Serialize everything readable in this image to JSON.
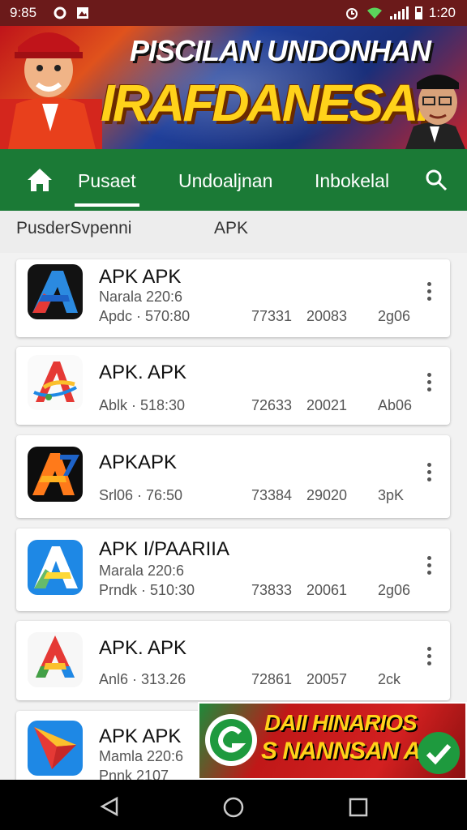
{
  "status_bar": {
    "time": "9:85",
    "clock": "1:20"
  },
  "banner": {
    "line1": "PISCILAN UNDONHAN",
    "line2": "IRAFDANESAI"
  },
  "nav": {
    "tabs": [
      {
        "label": "Pusaet"
      },
      {
        "label": "Undoaljnan"
      },
      {
        "label": "Inbokelal"
      }
    ]
  },
  "subtabs": [
    {
      "label": "PusderSvpenni"
    },
    {
      "label": "APK"
    }
  ],
  "apps": [
    {
      "name": "APK APK",
      "sub": "Narala 220:6",
      "meta": [
        "Apdc · 570:80",
        "77331",
        "20083",
        "2g06"
      ]
    },
    {
      "name": "APK. APK",
      "sub": "",
      "meta": [
        "Ablk · 518:30",
        "72633",
        "20021",
        "Ab06"
      ]
    },
    {
      "name": "APKAPK",
      "sub": "",
      "meta": [
        "Srl06 · 76:50",
        "73384",
        "29020",
        "3pK"
      ]
    },
    {
      "name": "APK I/PAARIIA",
      "sub": "Marala 220:6",
      "meta": [
        "Prndk · 510:30",
        "73833",
        "20061",
        "2g06"
      ]
    },
    {
      "name": "APK. APK",
      "sub": "",
      "meta": [
        "Anl6 · 313.26",
        "72861",
        "20057",
        "2ck"
      ]
    },
    {
      "name": "APK APK",
      "sub": "Mamla 220:6",
      "meta": [
        "Pnnk 2107"
      ]
    }
  ],
  "ad": {
    "line1": "DAII HINARIOS",
    "line2": "S NANNSAN APK"
  },
  "colors": {
    "status_bar": "#6b1a1a",
    "nav": "#1b7a36",
    "accent": "#ffd21a"
  }
}
